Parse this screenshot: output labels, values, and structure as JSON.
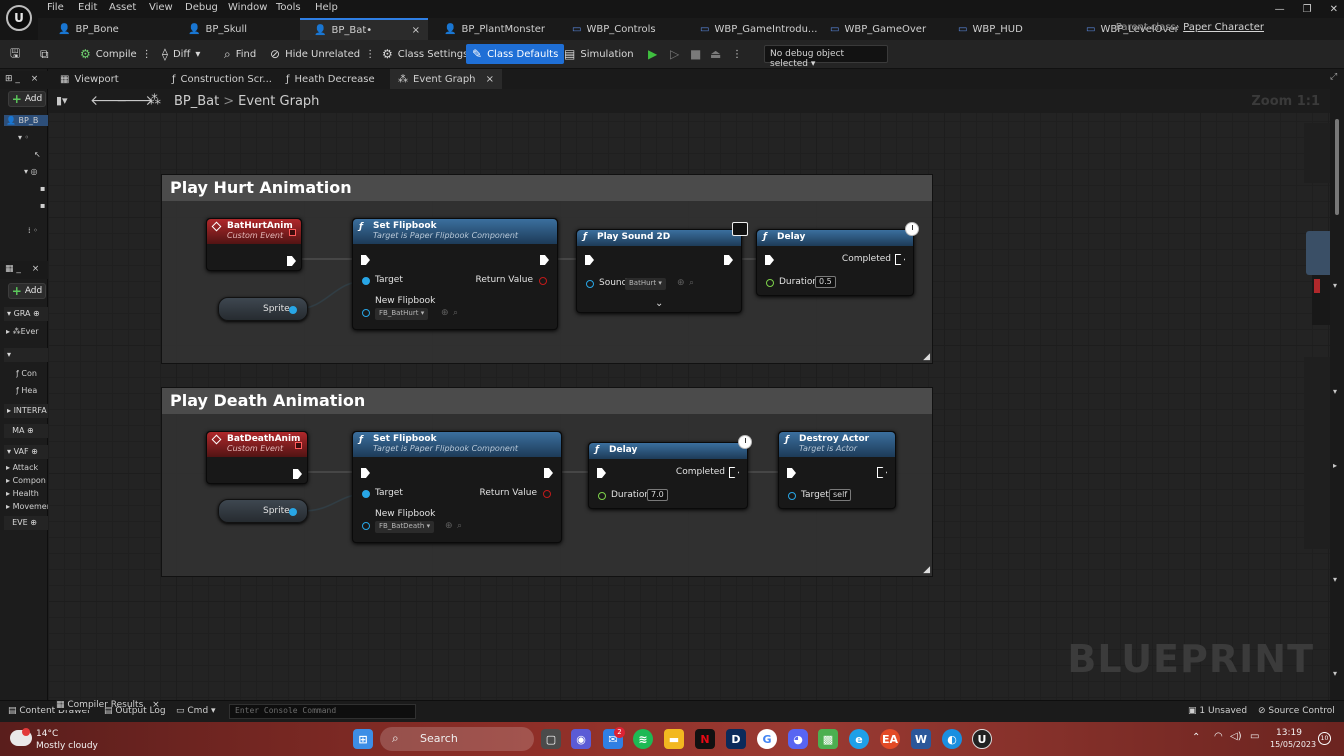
{
  "menu": [
    "File",
    "Edit",
    "Asset",
    "View",
    "Debug",
    "Window",
    "Tools",
    "Help"
  ],
  "doc_tabs": [
    {
      "label": "BP_Bone",
      "icon": "person-icon"
    },
    {
      "label": "BP_Skull",
      "icon": "person-icon"
    },
    {
      "label": "BP_Bat•",
      "icon": "person-icon",
      "active": true,
      "close": "×"
    },
    {
      "label": "BP_PlantMonster",
      "icon": "person-icon"
    },
    {
      "label": "WBP_Controls",
      "icon": "widget-icon"
    },
    {
      "label": "WBP_GameIntrodu...",
      "icon": "widget-icon"
    },
    {
      "label": "WBP_GameOver",
      "icon": "widget-icon"
    },
    {
      "label": "WBP_HUD",
      "icon": "widget-icon"
    },
    {
      "label": "WBP_LevelOver",
      "icon": "widget-icon"
    }
  ],
  "parent_class": {
    "label": "Parent class:",
    "value": "Paper Character"
  },
  "toolbar": {
    "compile": "Compile",
    "diff": "Diff",
    "find": "Find",
    "hide_unrelated": "Hide Unrelated",
    "class_settings": "Class Settings",
    "class_defaults": "Class Defaults",
    "simulation": "Simulation",
    "debug_object": "No debug object selected"
  },
  "left_panel": {
    "tab1": "_",
    "add1": "Add",
    "root_item": "BP_B",
    "tab2": "_",
    "add2": "Add",
    "graphs": "GRA",
    "event_graph": "Ever",
    "functions": [
      "Con",
      "Hea"
    ],
    "interfaces": "INTERFA",
    "macros": "MA",
    "variables": "VAF",
    "var_items": [
      "Attack",
      "Compon",
      "Health",
      "Movemer"
    ],
    "dispatchers": "EVE"
  },
  "graph_tabs": [
    {
      "label": "Viewport"
    },
    {
      "label": "Construction Scr..."
    },
    {
      "label": "Heath Decrease"
    },
    {
      "label": "Event Graph",
      "active": true,
      "close": "×"
    }
  ],
  "breadcrumb": {
    "root": "BP_Bat",
    "sep": ">",
    "current": "Event Graph"
  },
  "zoom": "Zoom 1:1",
  "watermark": "BLUEPRINT",
  "hurt": {
    "comment": "Play Hurt Animation",
    "event": {
      "title": "BatHurtAnim",
      "sub": "Custom Event"
    },
    "sprite": "Sprite",
    "set_flipbook": {
      "title": "Set Flipbook",
      "sub": "Target is Paper Flipbook Component",
      "target": "Target",
      "return": "Return Value",
      "new": "New Flipbook",
      "asset": "FB_BatHurt"
    },
    "play_sound": {
      "title": "Play Sound 2D",
      "sound": "Sound",
      "asset": "BatHurt"
    },
    "delay": {
      "title": "Delay",
      "completed": "Completed",
      "duration": "Duration",
      "value": "0.5"
    }
  },
  "death": {
    "comment": "Play Death Animation",
    "event": {
      "title": "BatDeathAnim",
      "sub": "Custom Event"
    },
    "sprite": "Sprite",
    "set_flipbook": {
      "title": "Set Flipbook",
      "sub": "Target is Paper Flipbook Component",
      "target": "Target",
      "return": "Return Value",
      "new": "New Flipbook",
      "asset": "FB_BatDeath"
    },
    "delay": {
      "title": "Delay",
      "completed": "Completed",
      "duration": "Duration",
      "value": "7.0"
    },
    "destroy": {
      "title": "Destroy Actor",
      "sub": "Target is Actor",
      "target": "Target",
      "value": "self"
    }
  },
  "status": {
    "content_drawer": "Content Drawer",
    "compiler_results": "Compiler Results",
    "output_log": "Output Log",
    "cmd": "Cmd",
    "console_placeholder": "Enter Console Command",
    "unsaved": "1 Unsaved",
    "source_control": "Source Control"
  },
  "taskbar": {
    "weather_temp": "14°C",
    "weather_desc": "Mostly cloudy",
    "search": "Search",
    "time": "13:19",
    "date": "15/05/2023",
    "mail_badge": "2",
    "notif": "10"
  },
  "colors": {
    "accent": "#1f6fd6",
    "exec_line": "#ffffff",
    "object_pin": "#28a6e6",
    "float_pin": "#7dd24a",
    "event_header": "#b0282b",
    "function_header": "#3b6f9e"
  }
}
